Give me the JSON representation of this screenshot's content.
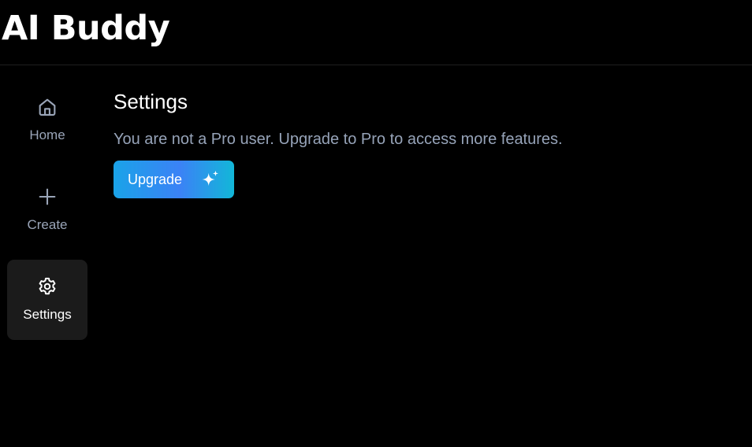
{
  "app": {
    "title": "AI Buddy"
  },
  "sidebar": {
    "items": [
      {
        "label": "Home",
        "icon": "home-icon",
        "active": false
      },
      {
        "label": "Create",
        "icon": "plus-icon",
        "active": false
      },
      {
        "label": "Settings",
        "icon": "gear-icon",
        "active": true
      }
    ]
  },
  "main": {
    "title": "Settings",
    "notice": "You are not a Pro user. Upgrade to Pro to access more features.",
    "upgrade_button": {
      "label": "Upgrade",
      "icon": "sparkles-icon"
    }
  },
  "colors": {
    "background": "#000000",
    "active_nav_bg": "#1b1b1b",
    "muted_text": "#9aa5b8",
    "button_gradient_start": "#1aa3e8",
    "button_gradient_mid": "#3b82f6",
    "button_gradient_end": "#12b7d8"
  }
}
